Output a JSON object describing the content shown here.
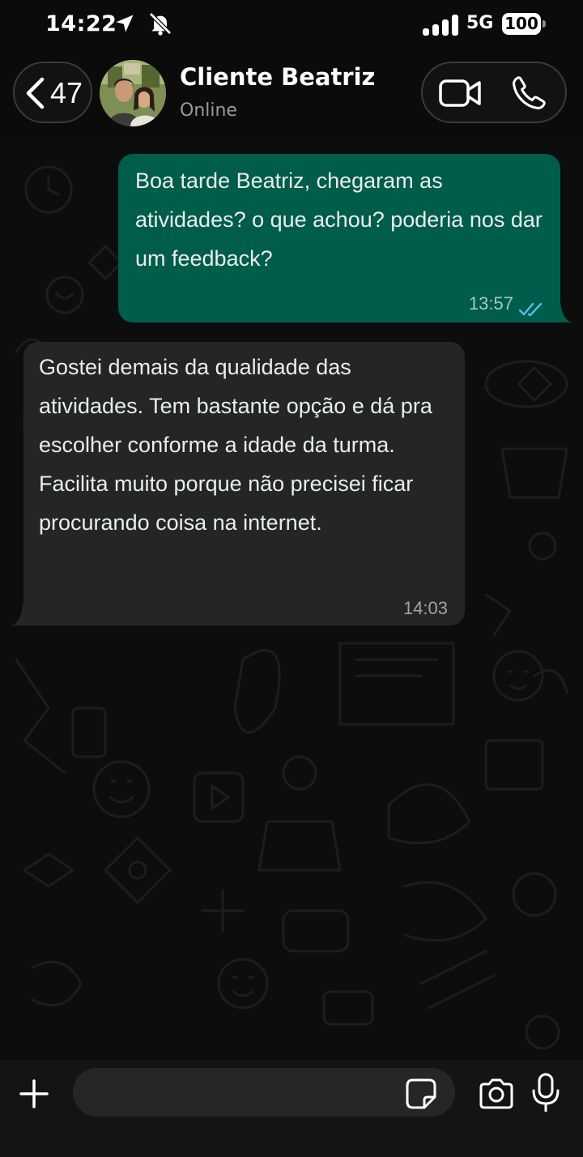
{
  "status_bar": {
    "time": "14:22",
    "network": "5G",
    "battery": "100",
    "icons": [
      "location-arrow-icon",
      "bell-muted-icon",
      "signal-bars-icon",
      "battery-icon"
    ]
  },
  "header": {
    "back_count": "47",
    "contact_name": "Cliente Beatriz",
    "contact_status": "Online",
    "icons": [
      "chevron-left-icon",
      "video-call-icon",
      "phone-call-icon"
    ]
  },
  "messages": [
    {
      "direction": "outgoing",
      "text": "Boa tarde Beatriz, chegaram as atividades? o que achou? poderia nos dar um feedback?",
      "time": "13:57",
      "status": "read"
    },
    {
      "direction": "incoming",
      "text": "Gostei demais da qualidade das atividades. Tem bastante opção e dá pra escolher conforme a idade da turma. Facilita muito porque não precisei ficar procurando coisa na internet.",
      "time": "14:03"
    }
  ],
  "composer": {
    "placeholder": "",
    "icons": [
      "plus-icon",
      "sticker-icon",
      "camera-icon",
      "microphone-icon"
    ]
  },
  "colors": {
    "outgoing_bubble": "#005c4b",
    "incoming_bubble": "#242626",
    "read_ticks": "#53bdeb",
    "background": "#0b0b0b"
  }
}
